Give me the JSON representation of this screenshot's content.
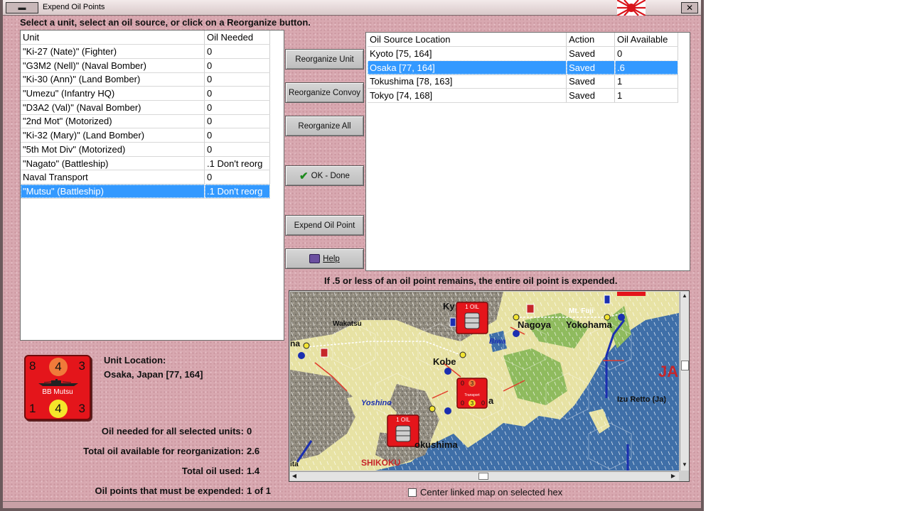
{
  "window": {
    "title": "Expend Oil Points",
    "close": "✕",
    "menu_glyph": "▬"
  },
  "instruction": "Select a unit, select an oil source, or click on a Reorganize button.",
  "units_table": {
    "headers": [
      "Unit",
      "Oil Needed"
    ],
    "rows": [
      [
        "\"Ki-27 (Nate)\" (Fighter)",
        "0"
      ],
      [
        "\"G3M2 (Nell)\" (Naval Bomber)",
        "0"
      ],
      [
        "\"Ki-30 (Ann)\" (Land Bomber)",
        "0"
      ],
      [
        "\"Umezu\" (Infantry HQ)",
        "0"
      ],
      [
        "\"D3A2 (Val)\" (Naval Bomber)",
        "0"
      ],
      [
        "\"2nd Mot\" (Motorized)",
        "0"
      ],
      [
        "\"Ki-32 (Mary)\" (Land Bomber)",
        "0"
      ],
      [
        "\"5th Mot Div\" (Motorized)",
        "0"
      ],
      [
        "\"Nagato\" (Battleship)",
        ".1 Don't reorg"
      ],
      [
        "Naval Transport",
        "0"
      ],
      [
        "\"Mutsu\" (Battleship)",
        ".1 Don't reorg"
      ]
    ],
    "selected_index": 10
  },
  "buttons": {
    "reorganize_unit": "Reorganize Unit",
    "reorganize_convoy": "Reorganize Convoy",
    "reorganize_all": "Reorganize All",
    "ok_done": "OK - Done",
    "expend_oil_point": "Expend Oil Point",
    "help": "Help"
  },
  "oil_table": {
    "headers": [
      "Oil Source Location",
      "Action",
      "Oil Available"
    ],
    "rows": [
      [
        "Kyoto [75, 164]",
        "Saved",
        "0"
      ],
      [
        "Osaka [77, 164]",
        "Saved",
        ".6"
      ],
      [
        "Tokushima [78, 163]",
        "Saved",
        "1"
      ],
      [
        "Tokyo [74, 168]",
        "Saved",
        "1"
      ]
    ],
    "selected_index": 1
  },
  "notice": "If .5 or less of an oil point remains, the entire oil point is expended.",
  "map": {
    "labels": {
      "kyoto_partial": "Ky",
      "wakatsu": "Wakatsu",
      "nagoya": "Nagoya",
      "yokohama": "Yokohama",
      "mt_fuji": "Mt. Fuji",
      "biwa": "Biwa",
      "kobe": "Kobe",
      "osaka_partial": "a",
      "left_partial_na": "na",
      "yoshino": "Yoshino",
      "tokushima": "okushima",
      "shikoku": "SHIKOKU",
      "izu_retto": "Izu Retto (Ja)",
      "ja_partial": "JA",
      "left_partial_ita": "ita"
    },
    "counters": {
      "oil_counter_label": "1 OIL",
      "transport_top_left": "0",
      "transport_top_center": "3",
      "transport_bottom_left": "0",
      "transport_bottom_center": "3",
      "transport_bottom_right": "0",
      "transport_label": "Transport"
    },
    "colors": {
      "sea": "#3f6fa8",
      "land": "#e7e2a4",
      "mountain": "#9a9486",
      "forest": "#8fbb5e",
      "counter_red": "#e4151b"
    }
  },
  "unit_counter": {
    "top_left": "8",
    "top_center": "4",
    "top_right": "3",
    "bottom_left": "1",
    "bottom_center": "4",
    "bottom_right": "3",
    "name": "BB Mutsu"
  },
  "unit_location": {
    "label": "Unit Location:",
    "value": "Osaka, Japan [77, 164]"
  },
  "stats": {
    "oil_needed_label": "Oil needed for all selected units:",
    "oil_needed_value": "0",
    "total_available_label": "Total oil available for reorganization:",
    "total_available_value": "2.6",
    "total_used_label": "Total oil used:",
    "total_used_value": "1.4",
    "expended_label": "Oil points that must be expended:",
    "expended_value": "1 of 1"
  },
  "center_option": {
    "label": "Center linked map on selected hex",
    "checked": false
  }
}
